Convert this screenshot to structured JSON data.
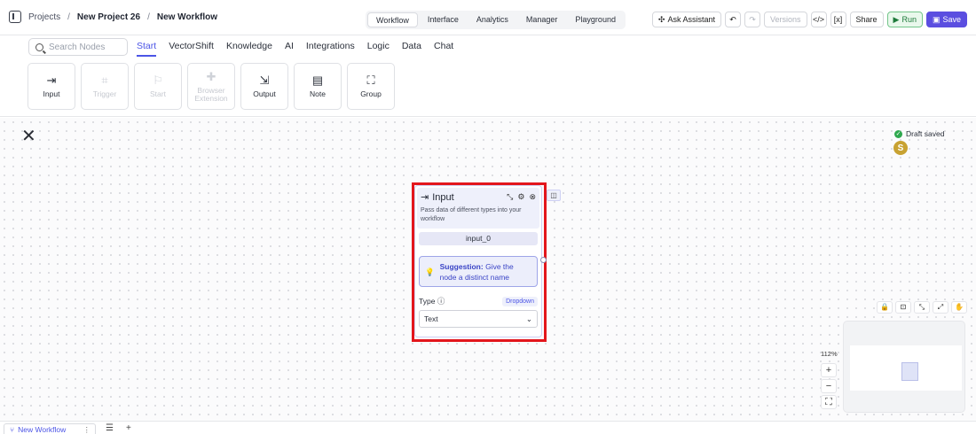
{
  "breadcrumb": {
    "projects": "Projects",
    "project": "New Project 26",
    "workflow": "New Workflow",
    "sep": "/"
  },
  "tabs": [
    "Workflow",
    "Interface",
    "Analytics",
    "Manager",
    "Playground"
  ],
  "actions": {
    "ask": "Ask Assistant",
    "versions": "Versions",
    "share": "Share",
    "run": "Run",
    "save": "Save"
  },
  "search": {
    "placeholder": "Search Nodes"
  },
  "categories": [
    "Start",
    "VectorShift",
    "Knowledge",
    "AI",
    "Integrations",
    "Logic",
    "Data",
    "Chat"
  ],
  "cards": [
    "Input",
    "Trigger",
    "Start",
    "Browser Extension",
    "Output",
    "Note",
    "Group"
  ],
  "status": {
    "draft": "Draft saved",
    "avatar": "S"
  },
  "node": {
    "title": "Input",
    "description": "Pass data of different types into your workflow",
    "name": "input_0",
    "suggestion_label": "Suggestion:",
    "suggestion_text": "Give the node a distinct name",
    "type_label": "Type",
    "type_badge": "Dropdown",
    "type_value": "Text"
  },
  "zoom": "112%",
  "bottom": {
    "tab": "New Workflow"
  },
  "colors": {
    "accent": "#4c55e6",
    "highlight": "#e3161c",
    "save": "#5b4ee0",
    "run": "#1d7a3a"
  }
}
